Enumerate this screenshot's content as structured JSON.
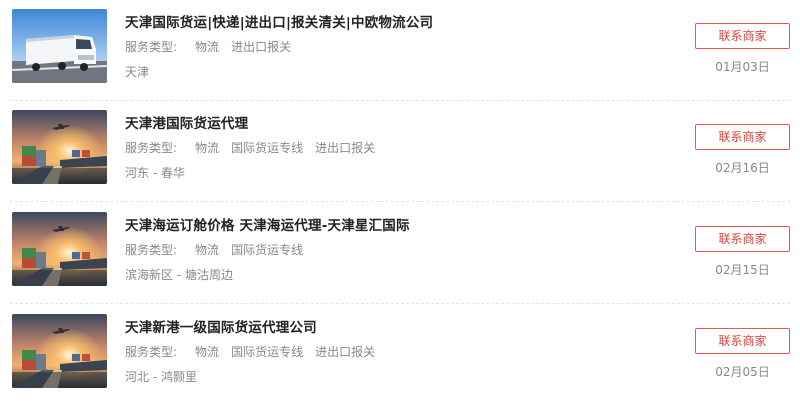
{
  "listings": [
    {
      "title": "天津国际货运|快递|进出口|报关清关|中欧物流公司",
      "service_label": "服务类型:",
      "tags": [
        "物流",
        "进出口报关"
      ],
      "location": "天津",
      "button": "联系商家",
      "date": "01月03日",
      "image": "truck"
    },
    {
      "title": "天津港国际货运代理",
      "service_label": "服务类型:",
      "tags": [
        "物流",
        "国际货运专线",
        "进出口报关"
      ],
      "location": "河东 - 春华",
      "button": "联系商家",
      "date": "02月16日",
      "image": "logistics"
    },
    {
      "title": "天津海运订舱价格 天津海运代理-天津星汇国际",
      "service_label": "服务类型:",
      "tags": [
        "物流",
        "国际货运专线"
      ],
      "location": "滨海新区 - 塘沽周边",
      "button": "联系商家",
      "date": "02月15日",
      "image": "logistics"
    },
    {
      "title": "天津新港一级国际货运代理公司",
      "service_label": "服务类型:",
      "tags": [
        "物流",
        "国际货运专线",
        "进出口报关"
      ],
      "location": "河北 - 鸿颢里",
      "button": "联系商家",
      "date": "02月05日",
      "image": "logistics"
    }
  ]
}
